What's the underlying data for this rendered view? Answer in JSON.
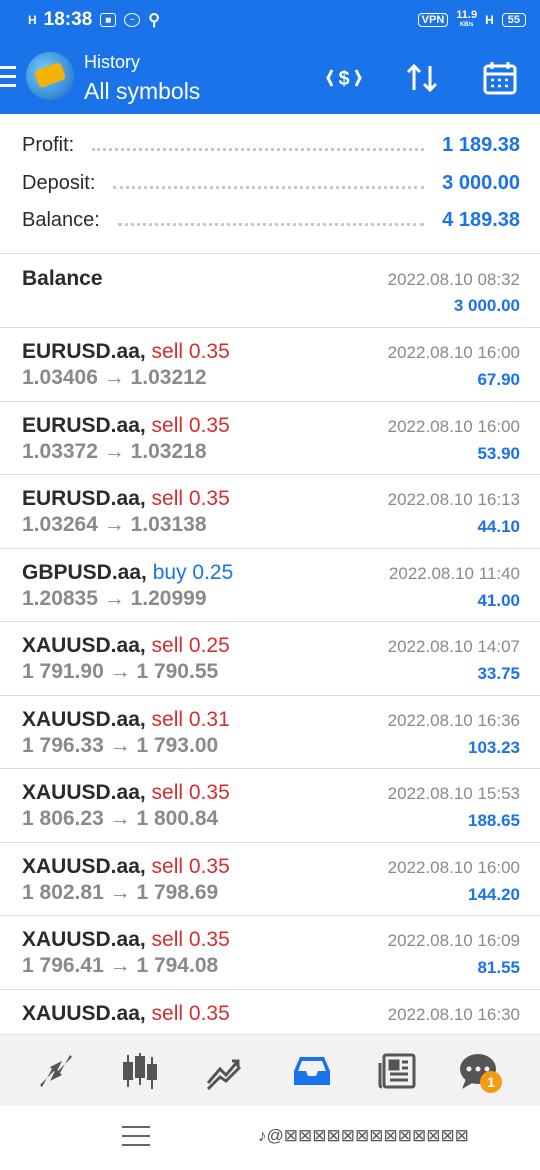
{
  "status_bar": {
    "signal": "H",
    "time": "18:38",
    "vpn": "VPN",
    "speed": "11.9",
    "speed_unit": "KB/s",
    "network": "H",
    "battery": "55"
  },
  "app_bar": {
    "title": "History",
    "subtitle": "All symbols",
    "icons": [
      "menu-icon",
      "app-logo",
      "currency-icon",
      "sort-icon",
      "calendar-icon"
    ]
  },
  "summary": [
    {
      "label": "Profit:",
      "value": "1 189.38"
    },
    {
      "label": "Deposit:",
      "value": "3 000.00"
    },
    {
      "label": "Balance:",
      "value": "4 189.38"
    }
  ],
  "balance_entry": {
    "label": "Balance",
    "date": "2022.08.10 08:32",
    "amount": "3 000.00"
  },
  "trades": [
    {
      "symbol": "EURUSD.aa,",
      "type": "sell 0.35",
      "side": "sell",
      "open": "1.03406",
      "arrow": "→",
      "close": "1.03212",
      "date": "2022.08.10 16:00",
      "profit": "67.90"
    },
    {
      "symbol": "EURUSD.aa,",
      "type": "sell 0.35",
      "side": "sell",
      "open": "1.03372",
      "arrow": "→",
      "close": "1.03218",
      "date": "2022.08.10 16:00",
      "profit": "53.90"
    },
    {
      "symbol": "EURUSD.aa,",
      "type": "sell 0.35",
      "side": "sell",
      "open": "1.03264",
      "arrow": "→",
      "close": "1.03138",
      "date": "2022.08.10 16:13",
      "profit": "44.10"
    },
    {
      "symbol": "GBPUSD.aa,",
      "type": "buy 0.25",
      "side": "buy",
      "open": "1.20835",
      "arrow": "→",
      "close": "1.20999",
      "date": "2022.08.10 11:40",
      "profit": "41.00"
    },
    {
      "symbol": "XAUUSD.aa,",
      "type": "sell 0.25",
      "side": "sell",
      "open": "1 791.90",
      "arrow": "→",
      "close": "1 790.55",
      "date": "2022.08.10 14:07",
      "profit": "33.75"
    },
    {
      "symbol": "XAUUSD.aa,",
      "type": "sell 0.31",
      "side": "sell",
      "open": "1 796.33",
      "arrow": "→",
      "close": "1 793.00",
      "date": "2022.08.10 16:36",
      "profit": "103.23"
    },
    {
      "symbol": "XAUUSD.aa,",
      "type": "sell 0.35",
      "side": "sell",
      "open": "1 806.23",
      "arrow": "→",
      "close": "1 800.84",
      "date": "2022.08.10 15:53",
      "profit": "188.65"
    },
    {
      "symbol": "XAUUSD.aa,",
      "type": "sell 0.35",
      "side": "sell",
      "open": "1 802.81",
      "arrow": "→",
      "close": "1 798.69",
      "date": "2022.08.10 16:00",
      "profit": "144.20"
    },
    {
      "symbol": "XAUUSD.aa,",
      "type": "sell 0.35",
      "side": "sell",
      "open": "1 796.41",
      "arrow": "→",
      "close": "1 794.08",
      "date": "2022.08.10 16:09",
      "profit": "81.55"
    },
    {
      "symbol": "XAUUSD.aa,",
      "type": "sell 0.35",
      "side": "sell",
      "open": "",
      "arrow": "",
      "close": "",
      "date": "2022.08.10 16:30",
      "profit": ""
    }
  ],
  "bottom_nav": {
    "items": [
      "quotes-icon",
      "chart-icon",
      "trade-icon",
      "history-icon",
      "news-icon",
      "chat-icon"
    ],
    "active": "history-icon",
    "chat_badge": "1"
  },
  "colors": {
    "primary": "#1a73e8",
    "sell": "#d32f2f",
    "buy": "#1a73e8",
    "badge": "#f39c12"
  }
}
